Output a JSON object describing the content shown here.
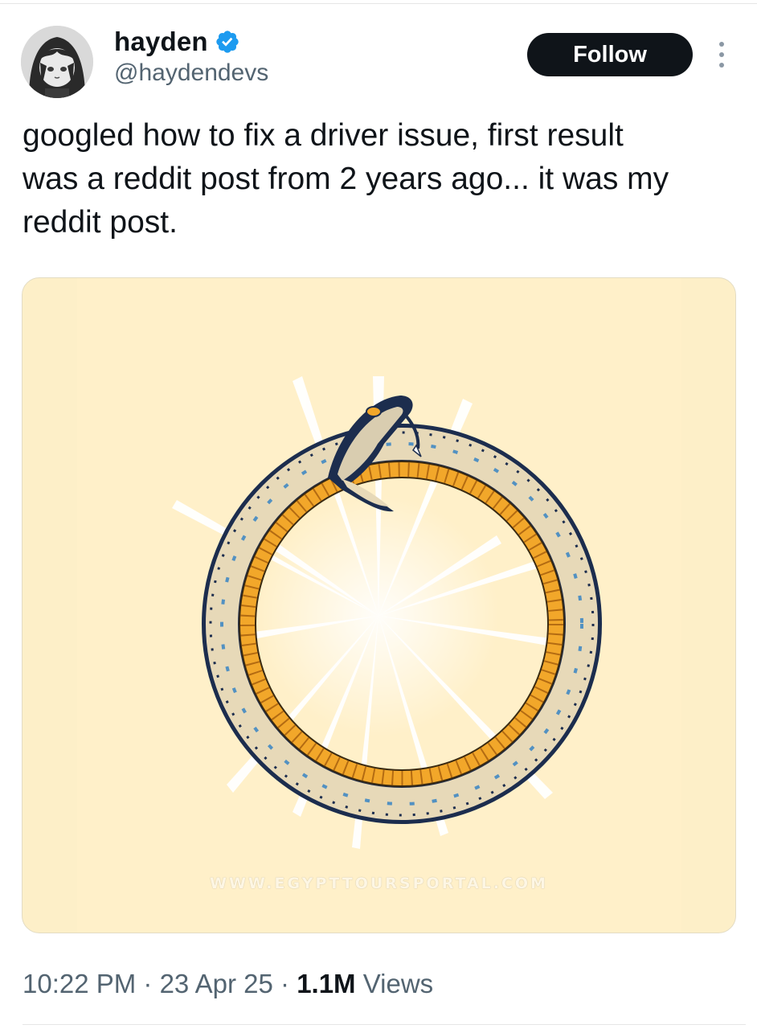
{
  "author": {
    "display_name": "hayden",
    "handle": "@haydendevs",
    "verified_icon": "verified-badge-icon",
    "avatar_icon": "avatar-image"
  },
  "follow_button": {
    "label": "Follow"
  },
  "more_menu": {
    "icon": "vertical-ellipsis-icon"
  },
  "tweet": {
    "text": "googled how to fix a driver issue, first result\nwas a reddit post from 2 years ago... it was my\nreddit post."
  },
  "media": {
    "watermark": "WWW.EGYPTTOURSPORTAL.COM",
    "background_color": "#fff0c9"
  },
  "meta": {
    "time": "10:22 PM",
    "separator_1": " · ",
    "date": "23 Apr 25",
    "separator_2": " · ",
    "views_count": "1.1M",
    "views_label": " Views"
  },
  "colors": {
    "primary_text": "#0f1419",
    "secondary_text": "#536471",
    "verified_blue": "#1d9bf0",
    "follow_bg": "#0f1419"
  }
}
